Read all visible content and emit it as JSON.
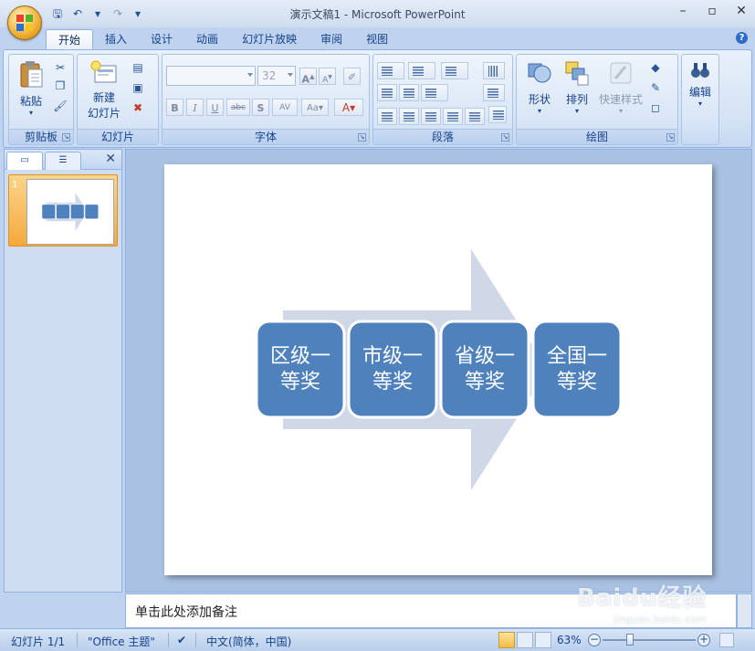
{
  "titlebar": {
    "title": "演示文稿1 - Microsoft PowerPoint",
    "minimize_icon": "minimize-icon",
    "maximize_icon": "restore-icon",
    "close_icon": "close-icon"
  },
  "quick_access": [
    "save-icon",
    "undo-icon",
    "redo-icon",
    "customize-icon"
  ],
  "tabs": [
    {
      "label": "开始",
      "active": true
    },
    {
      "label": "插入"
    },
    {
      "label": "设计"
    },
    {
      "label": "动画"
    },
    {
      "label": "幻灯片放映"
    },
    {
      "label": "审阅"
    },
    {
      "label": "视图"
    }
  ],
  "ribbon": {
    "clipboard": {
      "label": "剪贴板",
      "paste": "粘贴"
    },
    "slides": {
      "label": "幻灯片",
      "new_slide_line1": "新建",
      "new_slide_line2": "幻灯片"
    },
    "font": {
      "label": "字体",
      "font_name": "",
      "font_size": "32"
    },
    "paragraph": {
      "label": "段落"
    },
    "drawing": {
      "label": "绘图",
      "shapes": "形状",
      "arrange": "排列",
      "quick_styles": "快速样式"
    },
    "editing": {
      "label": "编辑"
    }
  },
  "slide_pane": {
    "slide_number": "1"
  },
  "slide": {
    "boxes": [
      {
        "line1": "区级一",
        "line2": "等奖"
      },
      {
        "line1": "市级一",
        "line2": "等奖"
      },
      {
        "line1": "省级一",
        "line2": "等奖"
      },
      {
        "line1": "全国一",
        "line2": "等奖"
      }
    ],
    "colors": {
      "box": "#4f81bd",
      "arrow": "#d0d8e8"
    }
  },
  "notes": {
    "placeholder": "单击此处添加备注"
  },
  "statusbar": {
    "slide_info": "幻灯片 1/1",
    "theme": "\"Office 主题\"",
    "language": "中文(简体，中国)",
    "zoom": "63%"
  },
  "watermark": {
    "text": "Baidu经验",
    "sub": "jingyan.baidu.com"
  }
}
